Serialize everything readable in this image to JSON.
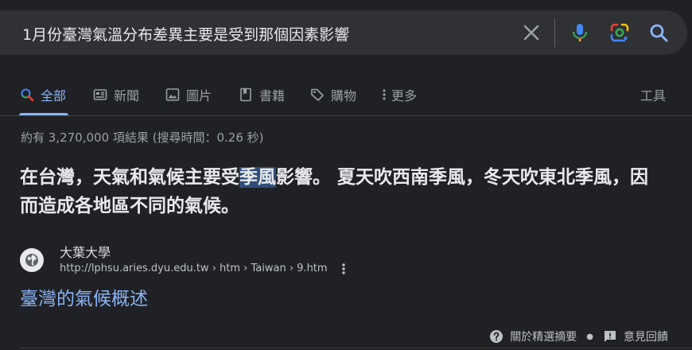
{
  "search": {
    "query": "1月份臺灣氣溫分布差異主要是受到那個因素影響"
  },
  "tabs": [
    {
      "label": "全部",
      "icon": "search-icon",
      "active": true
    },
    {
      "label": "新聞",
      "icon": "news-icon"
    },
    {
      "label": "圖片",
      "icon": "image-icon"
    },
    {
      "label": "書籍",
      "icon": "book-icon"
    },
    {
      "label": "購物",
      "icon": "tag-icon"
    },
    {
      "label": "更多",
      "icon": "more-vert-icon"
    }
  ],
  "tools_label": "工具",
  "stats": "約有 3,270,000 項結果 (搜尋時間：0.26 秒)",
  "featured_snippet": {
    "before": "在台灣，天氣和氣候主要受",
    "highlight": "季風",
    "after": "影響。 夏天吹西南季風，冬天吹東北季風，因而造成各地區不同的氣候。"
  },
  "result": {
    "site_name": "大葉大學",
    "url": "http://lphsu.aries.dyu.edu.tw › htm › Taiwan › 9.htm",
    "title": "臺灣的氣候概述"
  },
  "footer": {
    "about_label": "關於精選摘要",
    "feedback_label": "意見回饋"
  },
  "colors": {
    "background": "#202124",
    "link": "#8ab4f8",
    "highlight": "#2f4d78"
  }
}
